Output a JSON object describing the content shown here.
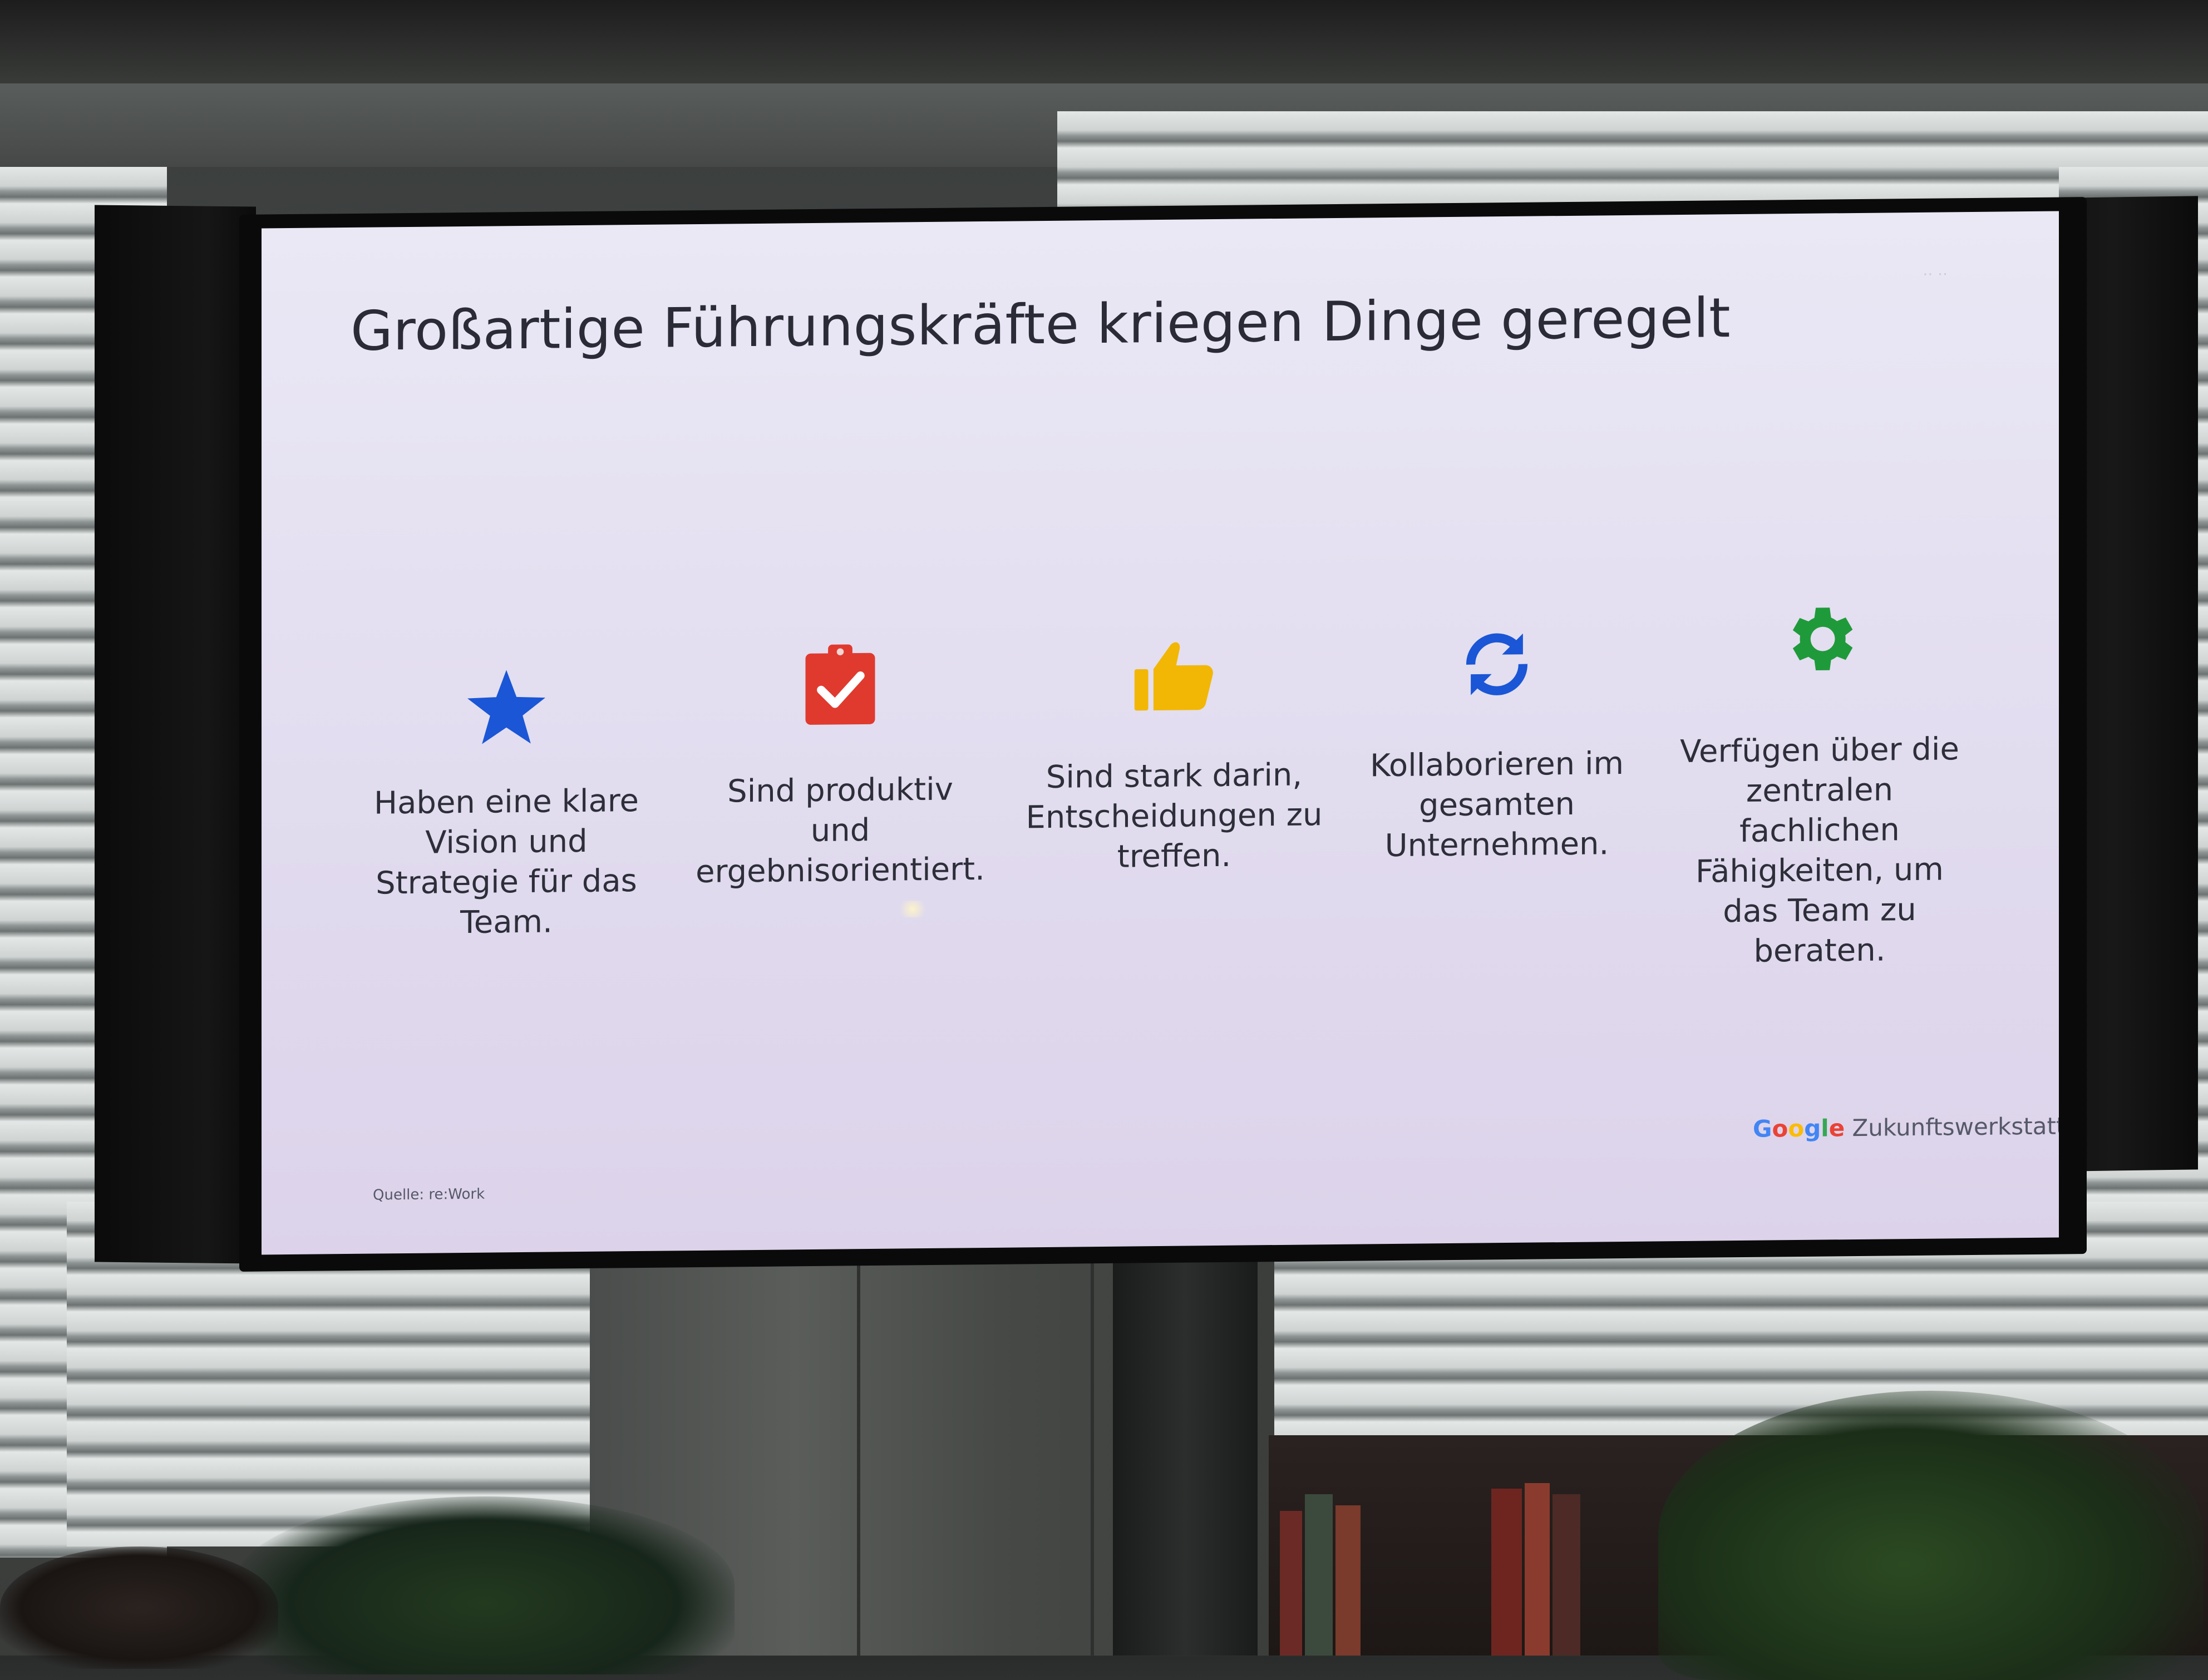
{
  "slide": {
    "title": "Großartige Führungskräfte kriegen Dinge geregelt",
    "items": [
      {
        "icon": "star-icon",
        "color": "#1a56d6",
        "text_lines": [
          "Haben eine klare",
          "Vision und",
          "Strategie für das",
          "Team."
        ]
      },
      {
        "icon": "clipboard-check-icon",
        "color": "#e03a2f",
        "text_lines": [
          "Sind produktiv",
          "und",
          "ergebnisorientiert."
        ]
      },
      {
        "icon": "thumbs-up-icon",
        "color": "#f2b705",
        "text_lines": [
          "Sind stark darin,",
          "Entscheidungen zu",
          "treffen."
        ]
      },
      {
        "icon": "sync-arrows-icon",
        "color": "#1a56d6",
        "text_lines": [
          "Kollaborieren im",
          "gesamten",
          "Unternehmen."
        ]
      },
      {
        "icon": "gear-icon",
        "color": "#1f9a3a",
        "text_lines": [
          "Verfügen über die",
          "zentralen",
          "fachlichen",
          "Fähigkeiten, um",
          "das Team zu",
          "beraten."
        ]
      }
    ],
    "source": "Quelle:  re:Work",
    "brand": {
      "google_letters": [
        "G",
        "o",
        "o",
        "g",
        "l",
        "e"
      ],
      "google_colors": [
        "#4285f4",
        "#ea4335",
        "#fbbc05",
        "#4285f4",
        "#34a853",
        "#ea4335"
      ],
      "suffix": " Zukunftswerkstatt"
    }
  }
}
